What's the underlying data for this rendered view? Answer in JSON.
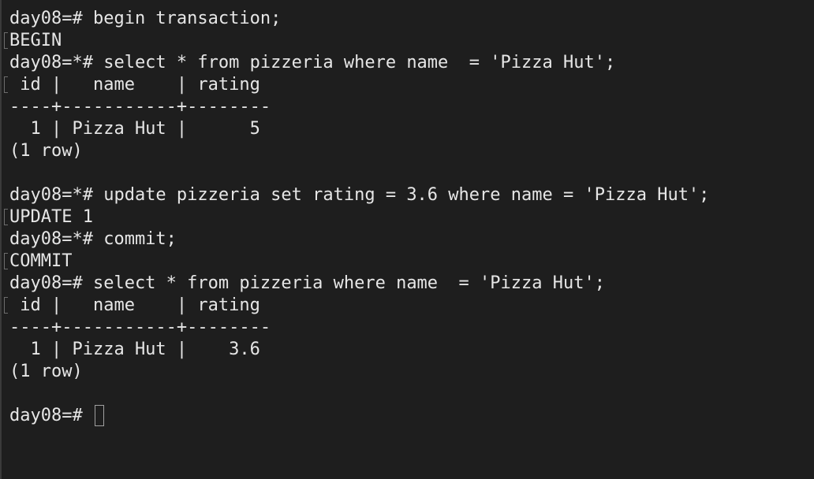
{
  "terminal": {
    "colors": {
      "background": "#1e1e1e",
      "text": "#e6e6e6",
      "mark": "#6d6d6d"
    },
    "lines": [
      {
        "text": "day08=# begin transaction;",
        "marked": false
      },
      {
        "text": "BEGIN",
        "marked": true
      },
      {
        "text": "day08=*# select * from pizzeria where name  = 'Pizza Hut';",
        "marked": false
      },
      {
        "text": " id |   name    | rating",
        "marked": true
      },
      {
        "text": "----+-----------+--------",
        "marked": false
      },
      {
        "text": "  1 | Pizza Hut |      5",
        "marked": false
      },
      {
        "text": "(1 row)",
        "marked": false
      },
      {
        "text": "",
        "marked": false
      },
      {
        "text": "day08=*# update pizzeria set rating = 3.6 where name = 'Pizza Hut';",
        "marked": false
      },
      {
        "text": "UPDATE 1",
        "marked": true
      },
      {
        "text": "day08=*# commit;",
        "marked": false
      },
      {
        "text": "COMMIT",
        "marked": true
      },
      {
        "text": "day08=# select * from pizzeria where name  = 'Pizza Hut';",
        "marked": false
      },
      {
        "text": " id |   name    | rating",
        "marked": true
      },
      {
        "text": "----+-----------+--------",
        "marked": false
      },
      {
        "text": "  1 | Pizza Hut |    3.6",
        "marked": false
      },
      {
        "text": "(1 row)",
        "marked": false
      },
      {
        "text": "",
        "marked": false
      }
    ],
    "prompt": "day08=# ",
    "input_value": ""
  }
}
